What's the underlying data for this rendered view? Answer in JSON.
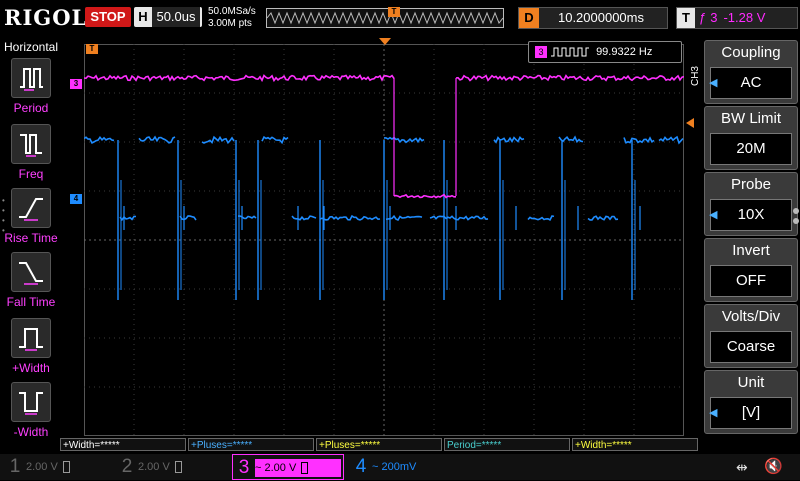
{
  "header": {
    "brand": "RIGOL",
    "run_state": "STOP",
    "timebase_label": "H",
    "timebase_value": "50.0us",
    "sample_rate": "50.0MSa/s",
    "memory_depth": "3.00M pts",
    "trigger_pos_marker": "T",
    "delay_label": "D",
    "delay_value": "10.2000000ms",
    "trigger_label": "T",
    "trigger_source": "3",
    "trigger_level": "-1.28 V"
  },
  "left_panel": {
    "title": "Horizontal",
    "items": [
      {
        "label": "Period",
        "icon": "period-icon"
      },
      {
        "label": "Freq",
        "icon": "freq-icon"
      },
      {
        "label": "Rise Time",
        "icon": "rise-time-icon"
      },
      {
        "label": "Fall Time",
        "icon": "fall-time-icon"
      },
      {
        "label": "+Width",
        "icon": "pos-width-icon"
      },
      {
        "label": "-Width",
        "icon": "neg-width-icon"
      }
    ]
  },
  "screen": {
    "marker_trigger": "T",
    "marker_ch3": "3",
    "marker_ch4": "4",
    "freq_readout_channel": "3",
    "freq_readout": "99.9322 Hz",
    "vertical_label": "CH3",
    "colors": {
      "ch3": "#ff30ff",
      "ch4": "#1e8cff",
      "trigger": "#f08020"
    }
  },
  "right_panel": {
    "items": [
      {
        "label": "Coupling",
        "value": "AC"
      },
      {
        "label": "BW Limit",
        "value": "20M"
      },
      {
        "label": "Probe",
        "value": "10X"
      },
      {
        "label": "Invert",
        "value": "OFF"
      },
      {
        "label": "Volts/Div",
        "value": "Coarse"
      },
      {
        "label": "Unit",
        "value": "[V]"
      }
    ]
  },
  "measurements": [
    {
      "text": "+Width=*****",
      "color": "#ffffff"
    },
    {
      "text": "+Pluses=*****",
      "color": "#4ab0ff"
    },
    {
      "text": "+Pluses=*****",
      "color": "#ffff40"
    },
    {
      "text": "Period=*****",
      "color": "#4ad0d0"
    },
    {
      "text": "+Width=*****",
      "color": "#ffff40"
    }
  ],
  "channels": [
    {
      "num": "1",
      "value": "2.00 V",
      "color": "#666666"
    },
    {
      "num": "2",
      "value": "2.00 V",
      "color": "#666666"
    },
    {
      "num": "3",
      "value": "2.00 V",
      "color": "#ff30ff"
    },
    {
      "num": "4",
      "value": "200mV",
      "color": "#1e8cff"
    }
  ]
}
